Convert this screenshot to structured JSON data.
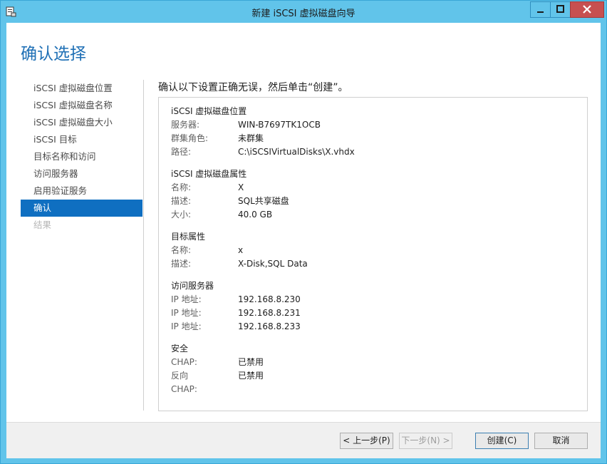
{
  "window": {
    "title": "新建 iSCSI 虚拟磁盘向导"
  },
  "page": {
    "title": "确认选择",
    "heading": "确认以下设置正确无误，然后单击“创建”。"
  },
  "nav": {
    "items": [
      {
        "label": "iSCSI 虚拟磁盘位置",
        "state": "normal"
      },
      {
        "label": "iSCSI 虚拟磁盘名称",
        "state": "normal"
      },
      {
        "label": "iSCSI 虚拟磁盘大小",
        "state": "normal"
      },
      {
        "label": "iSCSI 目标",
        "state": "normal"
      },
      {
        "label": "目标名称和访问",
        "state": "normal"
      },
      {
        "label": "访问服务器",
        "state": "normal"
      },
      {
        "label": "启用验证服务",
        "state": "normal"
      },
      {
        "label": "确认",
        "state": "active"
      },
      {
        "label": "结果",
        "state": "disabled"
      }
    ]
  },
  "sections": [
    {
      "title": "iSCSI 虚拟磁盘位置",
      "rows": [
        {
          "label": "服务器:",
          "value": "WIN-B7697TK1OCB"
        },
        {
          "label": "群集角色:",
          "value": "未群集"
        },
        {
          "label": "路径:",
          "value": "C:\\iSCSIVirtualDisks\\X.vhdx"
        }
      ]
    },
    {
      "title": "iSCSI 虚拟磁盘属性",
      "rows": [
        {
          "label": "名称:",
          "value": "X"
        },
        {
          "label": "描述:",
          "value": "SQL共享磁盘"
        },
        {
          "label": "大小:",
          "value": "40.0 GB"
        }
      ]
    },
    {
      "title": "目标属性",
      "rows": [
        {
          "label": "名称:",
          "value": "x"
        },
        {
          "label": "描述:",
          "value": "X-Disk,SQL Data"
        }
      ]
    },
    {
      "title": "访问服务器",
      "rows": [
        {
          "label": "IP 地址:",
          "value": "192.168.8.230"
        },
        {
          "label": "IP 地址:",
          "value": "192.168.8.231"
        },
        {
          "label": "IP 地址:",
          "value": "192.168.8.233"
        }
      ]
    },
    {
      "title": "安全",
      "rows": [
        {
          "label": "CHAP:",
          "value": "已禁用"
        },
        {
          "label": "反向 CHAP:",
          "value": "已禁用"
        }
      ]
    }
  ],
  "buttons": {
    "prev": "< 上一步(P)",
    "next": "下一步(N) >",
    "create": "创建(C)",
    "cancel": "取消"
  },
  "colors": {
    "titlebar": "#61c4ea",
    "accent_title": "#1e6fb5",
    "nav_active": "#0f6fc1",
    "close_button": "#c75050"
  },
  "icons": {
    "app": "wizard-icon",
    "minimize": "minimize-icon",
    "maximize": "maximize-icon",
    "close": "close-icon"
  }
}
